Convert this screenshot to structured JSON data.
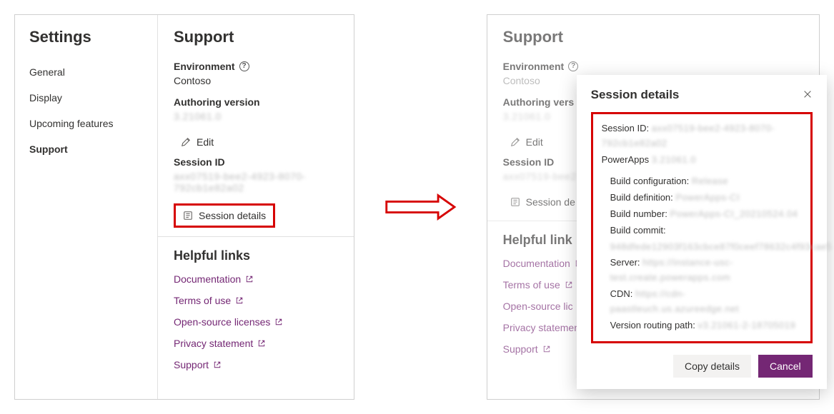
{
  "left": {
    "sidebar": {
      "title": "Settings",
      "items": [
        {
          "label": "General",
          "active": false
        },
        {
          "label": "Display",
          "active": false
        },
        {
          "label": "Upcoming features",
          "active": false
        },
        {
          "label": "Support",
          "active": true
        }
      ]
    },
    "main": {
      "title": "Support",
      "env_label": "Environment",
      "env_value": "Contoso",
      "authver_label": "Authoring version",
      "authver_value": "3.21061.0",
      "edit_label": "Edit",
      "session_label": "Session ID",
      "session_value": "axx07519-bee2-4923-8070-792cb1e82a02",
      "session_details_label": "Session details",
      "links_title": "Helpful links",
      "links": [
        "Documentation",
        "Terms of use",
        "Open-source licenses",
        "Privacy statement",
        "Support"
      ]
    }
  },
  "right": {
    "main": {
      "title": "Support",
      "env_label": "Environment",
      "env_value": "Contoso",
      "authver_label": "Authoring vers",
      "authver_value": "3.21061.0",
      "edit_label": "Edit",
      "session_label": "Session ID",
      "session_value": "axx07519-bee2",
      "session_details_label": "Session de",
      "links_title": "Helpful link",
      "links": [
        "Documentation",
        "Terms of use",
        "Open-source lic",
        "Privacy statement",
        "Support"
      ]
    },
    "dialog": {
      "title": "Session details",
      "sessionid_label": "Session ID:",
      "sessionid_val": "axx07519-bee2-4923-8070-792cb1e82a02",
      "powerapps_label": "PowerApps",
      "powerapps_val": "3.21061.0",
      "buildcfg_label": "Build configuration:",
      "buildcfg_val": "Release",
      "builddef_label": "Build definition:",
      "builddef_val": "PowerApps-CI",
      "buildnum_label": "Build number:",
      "buildnum_val": "PowerApps-CI_20210524.04",
      "buildcommit_label": "Build commit:",
      "buildcommit_val": "948dfede12903f163cbce87f0ceef78632c4f93cae5",
      "server_label": "Server:",
      "server_val": "https://instance-usc-test.create.powerapps.com",
      "cdn_label": "CDN:",
      "cdn_val": "https://cdn-paastleuch.us.azureedge.net",
      "vrp_label": "Version routing path:",
      "vrp_val": "v3.21061-2-18705019",
      "copy_label": "Copy details",
      "cancel_label": "Cancel"
    }
  }
}
